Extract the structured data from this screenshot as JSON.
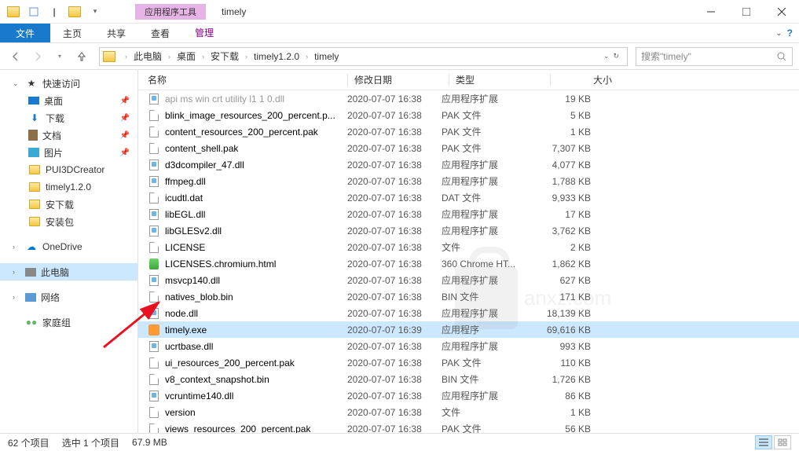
{
  "window": {
    "context_tab": "应用程序工具",
    "title": "timely"
  },
  "ribbon": {
    "file": "文件",
    "home": "主页",
    "share": "共享",
    "view": "查看",
    "manage": "管理"
  },
  "breadcrumb": {
    "pc": "此电脑",
    "desktop": "桌面",
    "folder1": "安下载",
    "folder2": "timely1.2.0",
    "folder3": "timely"
  },
  "search": {
    "placeholder": "搜索\"timely\""
  },
  "sidebar": {
    "quick": "快速访问",
    "desktop": "桌面",
    "downloads": "下载",
    "documents": "文档",
    "pictures": "图片",
    "pui3d": "PUI3DCreator",
    "timely": "timely1.2.0",
    "anxia": "安下载",
    "anzhuang": "安装包",
    "onedrive": "OneDrive",
    "thispc": "此电脑",
    "network": "网络",
    "homegroup": "家庭组"
  },
  "columns": {
    "name": "名称",
    "date": "修改日期",
    "type": "类型",
    "size": "大小"
  },
  "files": [
    {
      "name": "api ms win crt utility l1 1 0.dll",
      "date": "2020-07-07 16:38",
      "type": "应用程序扩展",
      "size": "19 KB",
      "icon": "dll",
      "cutoff": true
    },
    {
      "name": "blink_image_resources_200_percent.p...",
      "date": "2020-07-07 16:38",
      "type": "PAK 文件",
      "size": "5 KB",
      "icon": "file"
    },
    {
      "name": "content_resources_200_percent.pak",
      "date": "2020-07-07 16:38",
      "type": "PAK 文件",
      "size": "1 KB",
      "icon": "file"
    },
    {
      "name": "content_shell.pak",
      "date": "2020-07-07 16:38",
      "type": "PAK 文件",
      "size": "7,307 KB",
      "icon": "file"
    },
    {
      "name": "d3dcompiler_47.dll",
      "date": "2020-07-07 16:38",
      "type": "应用程序扩展",
      "size": "4,077 KB",
      "icon": "dll"
    },
    {
      "name": "ffmpeg.dll",
      "date": "2020-07-07 16:38",
      "type": "应用程序扩展",
      "size": "1,788 KB",
      "icon": "dll"
    },
    {
      "name": "icudtl.dat",
      "date": "2020-07-07 16:38",
      "type": "DAT 文件",
      "size": "9,933 KB",
      "icon": "file"
    },
    {
      "name": "libEGL.dll",
      "date": "2020-07-07 16:38",
      "type": "应用程序扩展",
      "size": "17 KB",
      "icon": "dll"
    },
    {
      "name": "libGLESv2.dll",
      "date": "2020-07-07 16:38",
      "type": "应用程序扩展",
      "size": "3,762 KB",
      "icon": "dll"
    },
    {
      "name": "LICENSE",
      "date": "2020-07-07 16:38",
      "type": "文件",
      "size": "2 KB",
      "icon": "file"
    },
    {
      "name": "LICENSES.chromium.html",
      "date": "2020-07-07 16:38",
      "type": "360 Chrome HT...",
      "size": "1,862 KB",
      "icon": "html"
    },
    {
      "name": "msvcp140.dll",
      "date": "2020-07-07 16:38",
      "type": "应用程序扩展",
      "size": "627 KB",
      "icon": "dll"
    },
    {
      "name": "natives_blob.bin",
      "date": "2020-07-07 16:38",
      "type": "BIN 文件",
      "size": "171 KB",
      "icon": "file"
    },
    {
      "name": "node.dll",
      "date": "2020-07-07 16:38",
      "type": "应用程序扩展",
      "size": "18,139 KB",
      "icon": "dll"
    },
    {
      "name": "timely.exe",
      "date": "2020-07-07 16:39",
      "type": "应用程序",
      "size": "69,616 KB",
      "icon": "exe-t",
      "selected": true
    },
    {
      "name": "ucrtbase.dll",
      "date": "2020-07-07 16:38",
      "type": "应用程序扩展",
      "size": "993 KB",
      "icon": "dll"
    },
    {
      "name": "ui_resources_200_percent.pak",
      "date": "2020-07-07 16:38",
      "type": "PAK 文件",
      "size": "110 KB",
      "icon": "file"
    },
    {
      "name": "v8_context_snapshot.bin",
      "date": "2020-07-07 16:38",
      "type": "BIN 文件",
      "size": "1,726 KB",
      "icon": "file"
    },
    {
      "name": "vcruntime140.dll",
      "date": "2020-07-07 16:38",
      "type": "应用程序扩展",
      "size": "86 KB",
      "icon": "dll"
    },
    {
      "name": "version",
      "date": "2020-07-07 16:38",
      "type": "文件",
      "size": "1 KB",
      "icon": "file"
    },
    {
      "name": "views_resources_200_percent.pak",
      "date": "2020-07-07 16:38",
      "type": "PAK 文件",
      "size": "56 KB",
      "icon": "file"
    }
  ],
  "status": {
    "items": "62 个项目",
    "selected": "选中 1 个项目",
    "size": "67.9 MB"
  },
  "watermark": "anxz.com"
}
